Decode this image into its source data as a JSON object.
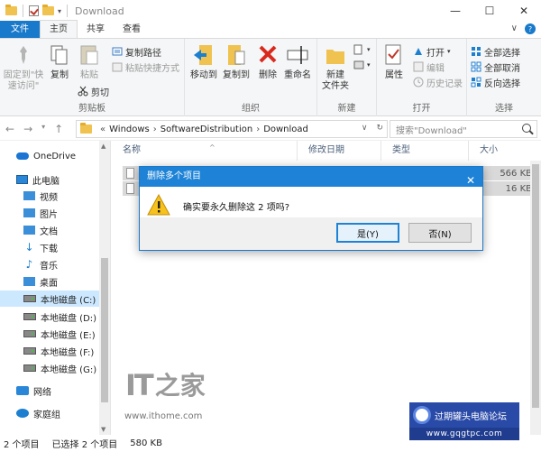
{
  "window": {
    "title": "Download",
    "controls": {
      "minimize": "—",
      "maximize": "☐",
      "close": "✕"
    }
  },
  "ribbon_tabs": [
    {
      "label": "文件"
    },
    {
      "label": "主页"
    },
    {
      "label": "共享"
    },
    {
      "label": "查看"
    }
  ],
  "ribbon": {
    "clipboard": {
      "label": "剪贴板",
      "pin": "固定到\"快\n速访问\"",
      "copy": "复制",
      "paste": "粘贴",
      "copy_path": "复制路径",
      "paste_shortcut": "粘贴快捷方式",
      "cut": "剪切"
    },
    "organize": {
      "label": "组织",
      "move_to": "移动到",
      "copy_to": "复制到",
      "delete": "删除",
      "rename": "重命名"
    },
    "new": {
      "label": "新建",
      "new_folder": "新建\n文件夹"
    },
    "open": {
      "label": "打开",
      "properties": "属性",
      "open": "打开",
      "edit": "编辑",
      "history": "历史记录"
    },
    "select": {
      "label": "选择",
      "select_all": "全部选择",
      "select_none": "全部取消",
      "invert": "反向选择"
    }
  },
  "nav": {
    "breadcrumb": [
      "Windows",
      "SoftwareDistribution",
      "Download"
    ],
    "search_placeholder": "搜索\"Download\""
  },
  "sidebar": {
    "items": [
      {
        "label": "OneDrive"
      },
      {
        "label": "此电脑"
      },
      {
        "label": "视频"
      },
      {
        "label": "图片"
      },
      {
        "label": "文档"
      },
      {
        "label": "下载"
      },
      {
        "label": "音乐"
      },
      {
        "label": "桌面"
      },
      {
        "label": "本地磁盘 (C:)"
      },
      {
        "label": "本地磁盘 (D:)"
      },
      {
        "label": "本地磁盘 (E:)"
      },
      {
        "label": "本地磁盘 (F:)"
      },
      {
        "label": "本地磁盘 (G:)"
      },
      {
        "label": "网络"
      },
      {
        "label": "家庭组"
      }
    ]
  },
  "filelist": {
    "columns": [
      "名称",
      "修改日期",
      "类型",
      "大小"
    ],
    "rows": [
      {
        "size": "566 KB"
      },
      {
        "size": "16 KB"
      }
    ]
  },
  "watermark": {
    "logo": "IT",
    "logo_zh": "之家",
    "url": "www.ithome.com"
  },
  "status": {
    "count": "2 个项目",
    "selected": "已选择 2 个项目",
    "size": "580 KB"
  },
  "dialog": {
    "title": "删除多个项目",
    "message": "确实要永久删除这 2 项吗?",
    "yes": "是(Y)",
    "no": "否(N)"
  },
  "badge": {
    "text": "过期罐头电脑论坛",
    "url": "www.gqgtpc.com"
  },
  "colors": {
    "accent": "#1979ca",
    "dialog_title": "#1e83d6",
    "selection": "#cce8ff",
    "folder": "#f0c24f",
    "delete_red": "#d9291c"
  }
}
